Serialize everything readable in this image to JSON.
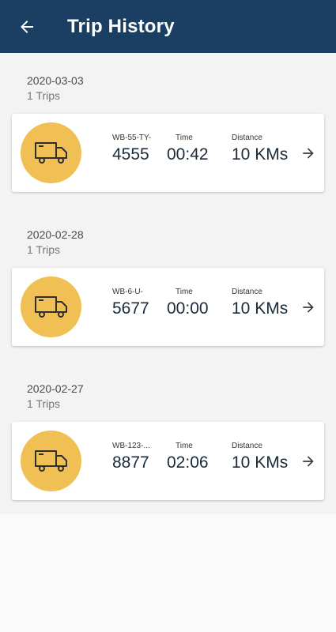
{
  "appbar": {
    "title": "Trip History",
    "back_icon": "arrow-left-icon",
    "background": "#1b3f62"
  },
  "labels": {
    "time": "Time",
    "distance": "Distance"
  },
  "trips": [
    {
      "date": "2020-03-03",
      "count": "1 Trips",
      "plate_prefix": "WB-55-TY-",
      "plate_number": "4555",
      "time": "00:42",
      "distance": "10 KMs"
    },
    {
      "date": "2020-02-28",
      "count": "1 Trips",
      "plate_prefix": "WB-6-U-",
      "plate_number": "5677",
      "time": "00:00",
      "distance": "10 KMs"
    },
    {
      "date": "2020-02-27",
      "count": "1 Trips",
      "plate_prefix": "WB-123-...",
      "plate_number": "8877",
      "time": "02:06",
      "distance": "10 KMs"
    }
  ],
  "colors": {
    "avatar": "#f0c054",
    "truck_icon": "#2f2f2f"
  },
  "icons": {
    "vehicle": "truck-icon",
    "open": "arrow-right-icon"
  }
}
